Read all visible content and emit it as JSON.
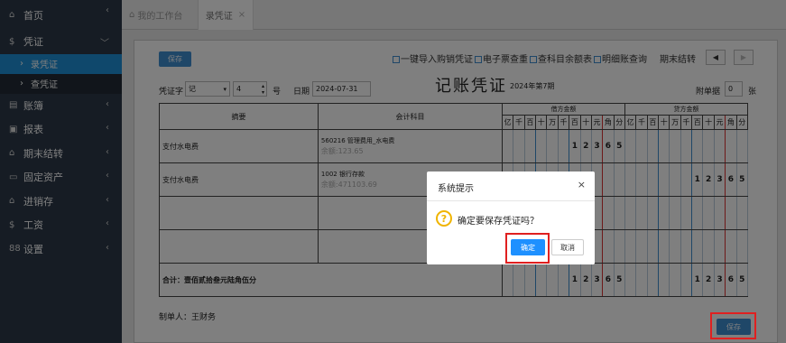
{
  "sidebar": {
    "items": [
      {
        "icon": "home-icon",
        "glyph": "⌂",
        "label": "首页"
      },
      {
        "icon": "dollar-icon",
        "glyph": "$",
        "label": "凭证",
        "expanded": true
      },
      {
        "icon": "ledger-icon",
        "glyph": "▤",
        "label": "账簿"
      },
      {
        "icon": "report-icon",
        "glyph": "▣",
        "label": "报表"
      },
      {
        "icon": "home-icon",
        "glyph": "⌂",
        "label": "期末结转"
      },
      {
        "icon": "monitor-icon",
        "glyph": "▭",
        "label": "固定资产"
      },
      {
        "icon": "home-icon",
        "glyph": "⌂",
        "label": "进销存"
      },
      {
        "icon": "dollar-icon",
        "glyph": "$",
        "label": "工资"
      },
      {
        "icon": "grid-icon",
        "glyph": "88",
        "label": "设置"
      }
    ],
    "sub_items": [
      {
        "label": "录凭证",
        "active": true
      },
      {
        "label": "查凭证",
        "active": false
      }
    ]
  },
  "tabs": {
    "home": "我的工作台",
    "current": "录凭证",
    "close": "×"
  },
  "toolbar": {
    "save": "保存",
    "links": [
      "一键导入购销凭证",
      "电子票查重",
      "查科目余额表",
      "明细账查询"
    ],
    "period_close": "期末结转",
    "prev": "◀",
    "next": "▶"
  },
  "voucher": {
    "word_label": "凭证字",
    "word_value": "记",
    "number": "4",
    "number_suffix": "号",
    "date_label": "日期",
    "date": "2024-07-31",
    "title": "记账凭证",
    "period": "2024年第7期",
    "attach_label": "附单据",
    "attach_count": "0",
    "attach_unit": "张",
    "col_summary": "摘要",
    "col_account": "会计科目",
    "col_debit": "借方金额",
    "col_credit": "贷方金额",
    "digit_headers": [
      "亿",
      "千",
      "百",
      "十",
      "万",
      "千",
      "百",
      "十",
      "元",
      "角",
      "分"
    ],
    "rows": [
      {
        "summary": "支付水电费",
        "account": "560216 管理费用_水电费",
        "balance": "余额:123.65",
        "debit": [
          "",
          "",
          "",
          "",
          "",
          "",
          "1",
          "2",
          "3",
          "6",
          "5"
        ],
        "credit": [
          "",
          "",
          "",
          "",
          "",
          "",
          "",
          "",
          "",
          "",
          ""
        ]
      },
      {
        "summary": "支付水电费",
        "account": "1002 银行存款",
        "balance": "余额:471103.69",
        "debit": [
          "",
          "",
          "",
          "",
          "",
          "",
          "",
          "",
          "",
          "",
          ""
        ],
        "credit": [
          "",
          "",
          "",
          "",
          "",
          "",
          "1",
          "2",
          "3",
          "6",
          "5"
        ]
      },
      {
        "summary": "",
        "account": "",
        "balance": "",
        "debit": [
          "",
          "",
          "",
          "",
          "",
          "",
          "",
          "",
          "",
          "",
          ""
        ],
        "credit": [
          "",
          "",
          "",
          "",
          "",
          "",
          "",
          "",
          "",
          "",
          ""
        ]
      },
      {
        "summary": "",
        "account": "",
        "balance": "",
        "debit": [
          "",
          "",
          "",
          "",
          "",
          "",
          "",
          "",
          "",
          "",
          ""
        ],
        "credit": [
          "",
          "",
          "",
          "",
          "",
          "",
          "",
          "",
          "",
          "",
          ""
        ]
      }
    ],
    "total_label": "合计：壹佰贰拾叁元陆角伍分",
    "total_debit": [
      "",
      "",
      "",
      "",
      "",
      "",
      "1",
      "2",
      "3",
      "6",
      "5"
    ],
    "total_credit": [
      "",
      "",
      "",
      "",
      "",
      "",
      "1",
      "2",
      "3",
      "6",
      "5"
    ],
    "maker": "制单人：王财务",
    "bottom_save": "保存"
  },
  "dialog": {
    "title": "系统提示",
    "close": "×",
    "icon": "question-icon",
    "message": "确定要保存凭证吗？",
    "ok": "确定",
    "cancel": "取消"
  },
  "colors": {
    "sidebar_bg": "#2c3848",
    "active_blue": "#1e90d8",
    "button_blue": "#3e8ed0",
    "highlight_red": "#e02020",
    "warning_yellow": "#f0b400"
  }
}
